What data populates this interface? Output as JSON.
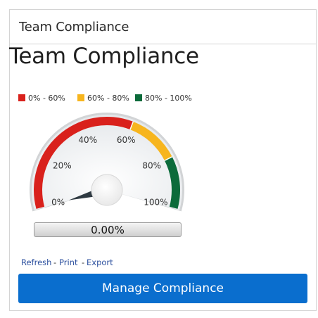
{
  "panel": {
    "header_title": "Team Compliance",
    "title": "Team Compliance"
  },
  "legend": [
    {
      "label": "0% - 60%",
      "color": "#d9211c"
    },
    {
      "label": "60% - 80%",
      "color": "#f7b51e"
    },
    {
      "label": "80% - 100%",
      "color": "#0c6b3b"
    }
  ],
  "gauge": {
    "value_percent": 0,
    "readout": "0.00%",
    "min": 0,
    "max": 100,
    "tick_labels": [
      "0%",
      "20%",
      "40%",
      "60%",
      "80%",
      "100%"
    ],
    "bands": [
      {
        "from": 0,
        "to": 60,
        "color": "#d9211c"
      },
      {
        "from": 60,
        "to": 80,
        "color": "#f7b51e"
      },
      {
        "from": 80,
        "to": 100,
        "color": "#0c6b3b"
      }
    ]
  },
  "links": {
    "refresh": "Refresh",
    "print": "Print",
    "export": "Export"
  },
  "actions": {
    "manage_label": "Manage Compliance"
  }
}
